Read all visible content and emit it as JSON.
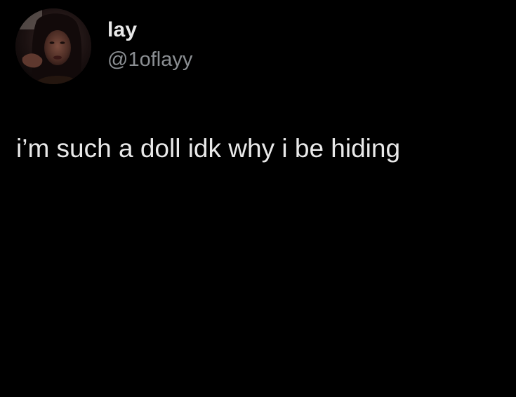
{
  "tweet": {
    "author": {
      "display_name": "lay",
      "handle": "@1oflayy",
      "avatar_icon": "profile-photo"
    },
    "text": "i’m such a doll idk why i be hiding"
  },
  "colors": {
    "background": "#000000",
    "primary_text": "#e9e9e9",
    "secondary_text": "#8b8f93"
  }
}
